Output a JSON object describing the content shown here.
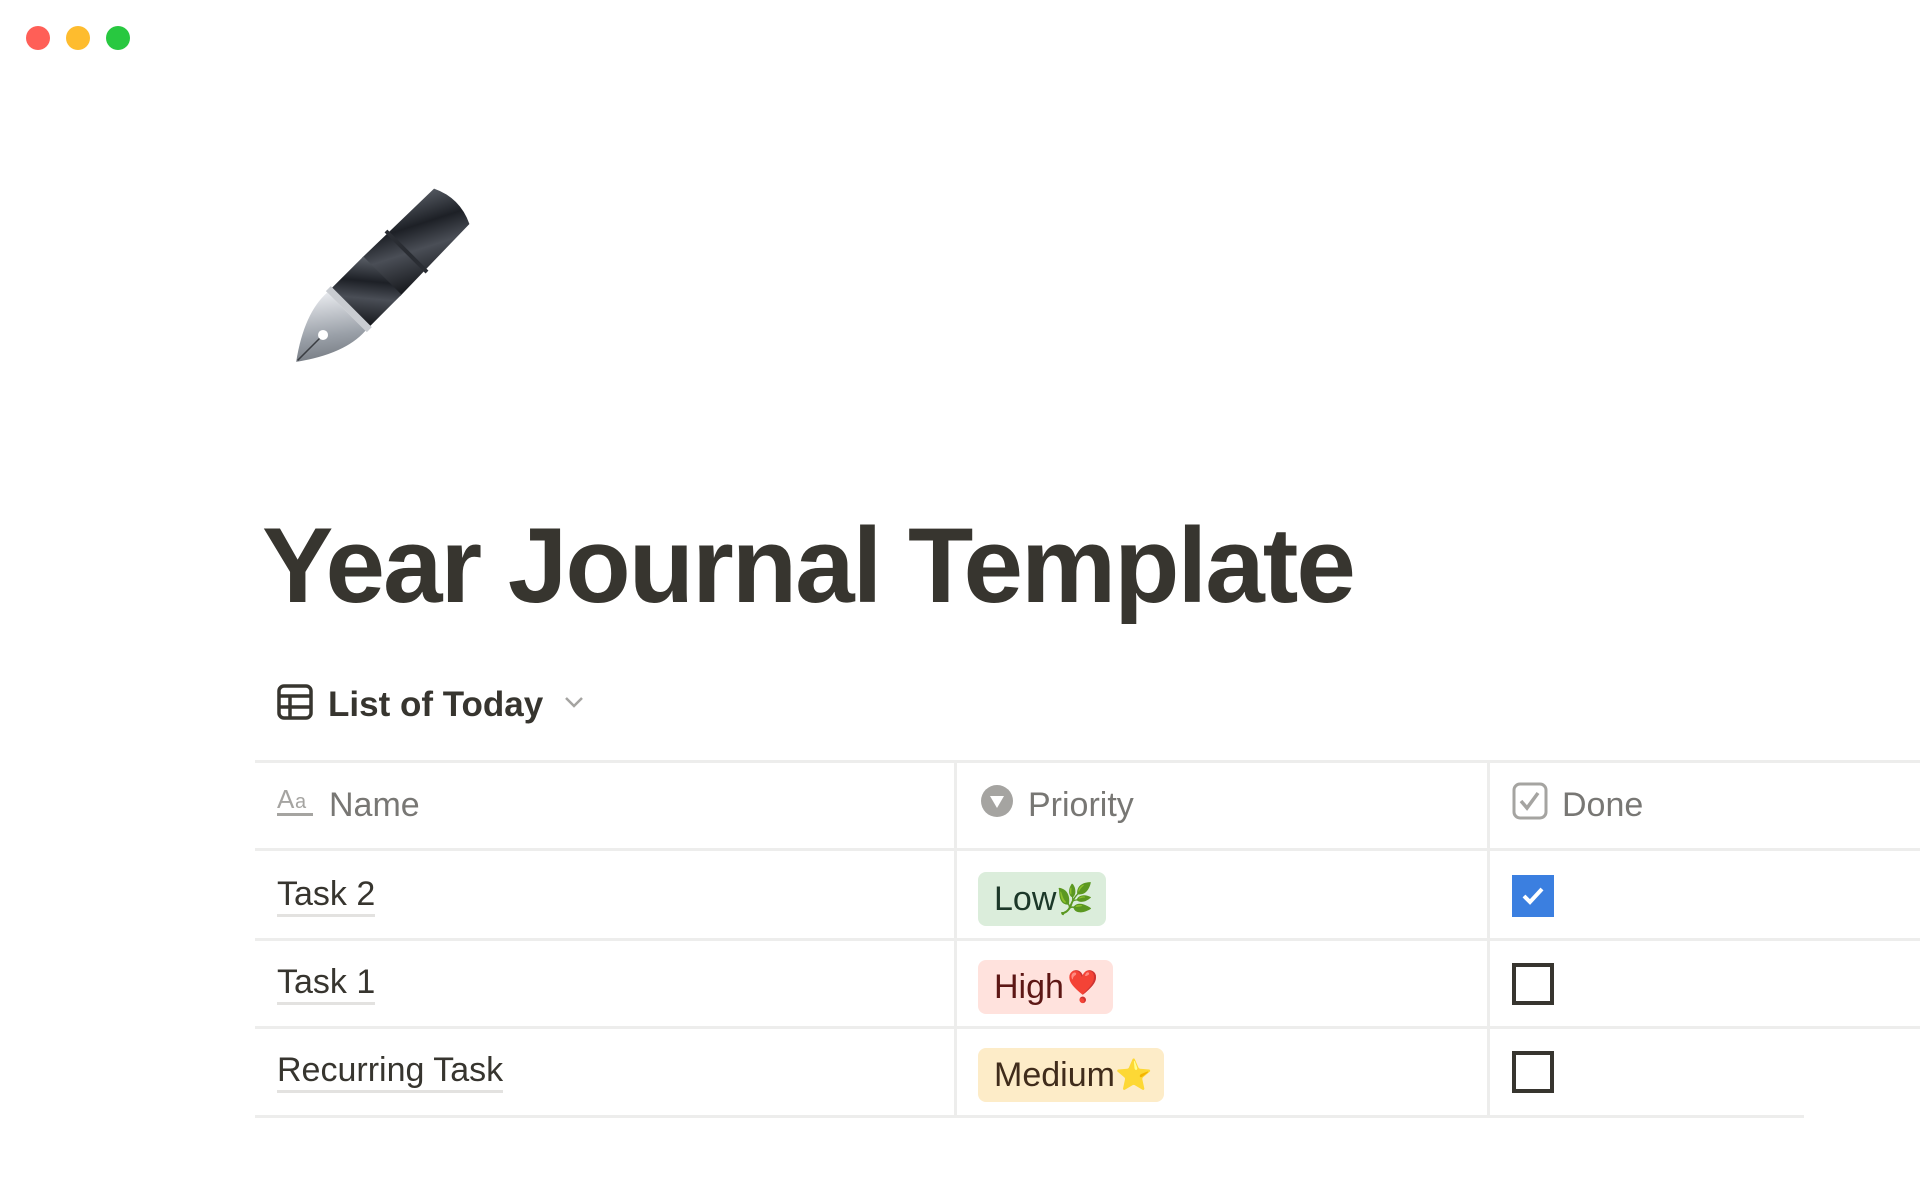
{
  "window": {
    "controls": [
      "close",
      "minimize",
      "maximize"
    ]
  },
  "page": {
    "icon": "fountain-pen-icon",
    "title": "Year Journal Template"
  },
  "database": {
    "view_icon": "table-icon",
    "title": "List of Today",
    "columns": [
      {
        "label": "Name",
        "icon": "text-type-icon"
      },
      {
        "label": "Priority",
        "icon": "select-icon"
      },
      {
        "label": "Done",
        "icon": "checkbox-icon"
      }
    ],
    "rows": [
      {
        "name": "Task 2",
        "priority": {
          "label": "Low",
          "emoji": "🌿",
          "bg": "#dbeddb",
          "fg": "#1c3829"
        },
        "done": true
      },
      {
        "name": "Task 1",
        "priority": {
          "label": "High",
          "emoji": "❣️",
          "bg": "#ffe2dd",
          "fg": "#5d1715"
        },
        "done": false
      },
      {
        "name": "Recurring Task",
        "priority": {
          "label": "Medium",
          "emoji": "⭐",
          "bg": "#fdecc8",
          "fg": "#402c1b"
        },
        "done": false
      }
    ]
  },
  "colors": {
    "text": "#37352f",
    "muted": "#787774",
    "border": "#ededec",
    "checkbox_checked": "#3b7fe0"
  }
}
